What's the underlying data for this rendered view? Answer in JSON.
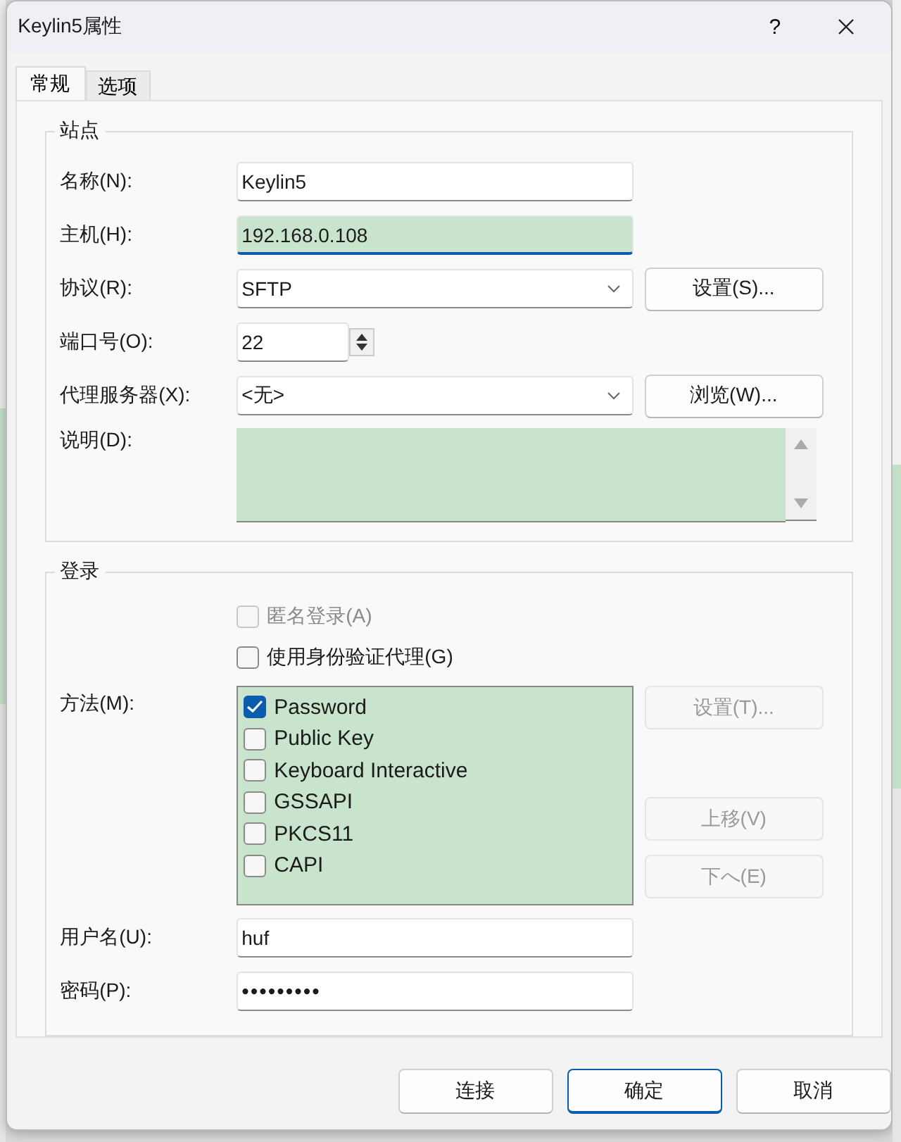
{
  "window": {
    "title": "Keylin5属性",
    "help": "?"
  },
  "tabs": [
    {
      "label": "常规",
      "selected": true
    },
    {
      "label": "选项",
      "selected": false
    }
  ],
  "site": {
    "title": "站点",
    "rows": [
      {
        "kind": "text",
        "label": "名称(N):",
        "value": "Keylin5",
        "highlighted": false,
        "focused": false
      },
      {
        "kind": "text",
        "label": "主机(H):",
        "value": "192.168.0.108",
        "highlighted": true,
        "focused": true
      },
      {
        "kind": "select",
        "label": "协议(R):",
        "value": "SFTP",
        "button": "设置(S)..."
      },
      {
        "kind": "spin",
        "label": "端口号(O):",
        "value": "22"
      },
      {
        "kind": "select",
        "label": "代理服务器(X):",
        "value": "<无>",
        "button": "浏览(W)..."
      },
      {
        "kind": "textarea",
        "label": "说明(D):"
      }
    ]
  },
  "login": {
    "title": "登录",
    "checkboxes": [
      {
        "label": "匿名登录(A)",
        "checked": false,
        "disabled": true
      },
      {
        "label": "使用身份验证代理(G)",
        "checked": false,
        "disabled": false
      }
    ],
    "methods": {
      "label": "方法(M):",
      "items": [
        {
          "label": "Password",
          "checked": true
        },
        {
          "label": "Public Key",
          "checked": false
        },
        {
          "label": "Keyboard Interactive",
          "checked": false
        },
        {
          "label": "GSSAPI",
          "checked": false
        },
        {
          "label": "PKCS11",
          "checked": false
        },
        {
          "label": "CAPI",
          "checked": false
        }
      ],
      "buttons": [
        {
          "label": "设置(T)...",
          "disabled": true
        },
        {
          "label": "上移(V)",
          "disabled": true
        },
        {
          "label": "下へ(E)",
          "disabled": true
        }
      ]
    },
    "username": {
      "label": "用户名(U):",
      "value": "huf"
    },
    "password": {
      "label": "密码(P):",
      "value": "•••••••••"
    }
  },
  "buttons": [
    {
      "label": "连接",
      "default": false
    },
    {
      "label": "确定",
      "default": true
    },
    {
      "label": "取消",
      "default": false
    }
  ]
}
